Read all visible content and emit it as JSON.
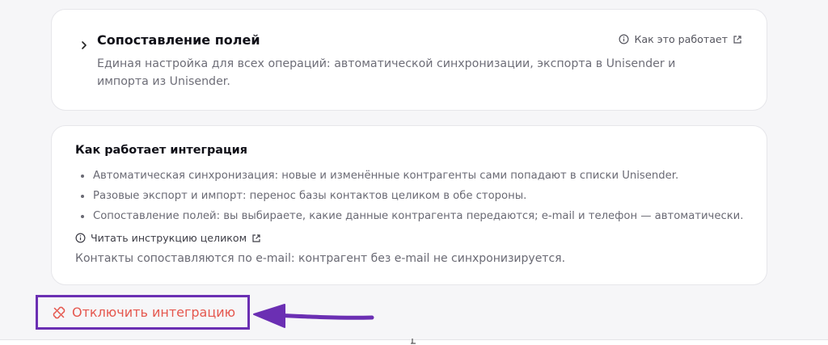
{
  "mapping_card": {
    "title": "Сопоставление полей",
    "description": "Единая настройка для всех операций: автоматической синхронизации, экспорта в Unisender и импорта из Unisender.",
    "how_it_works_link": "Как это работает"
  },
  "howto_card": {
    "title": "Как работает интеграция",
    "bullets": [
      "Автоматическая синхронизация: новые и изменённые контрагенты сами попадают в списки Unisender.",
      "Разовые экспорт и импорт: перенос базы контактов целиком в обе стороны.",
      "Сопоставление полей: вы выбираете, какие данные контрагента передаются; e-mail и телефон — автоматически."
    ],
    "read_link": "Читать инструкцию целиком",
    "note": "Контакты сопоставляются по e-mail: контрагент без e-mail не синхронизируется."
  },
  "actions": {
    "disable_label": "Отключить интеграцию"
  },
  "icons": {
    "expand": "chevron-right-icon",
    "info": "info-circle-icon",
    "external": "external-link-icon",
    "unlink": "unlink-icon"
  },
  "colors": {
    "danger": "#e5574e",
    "annotation": "#6b2fb3"
  }
}
